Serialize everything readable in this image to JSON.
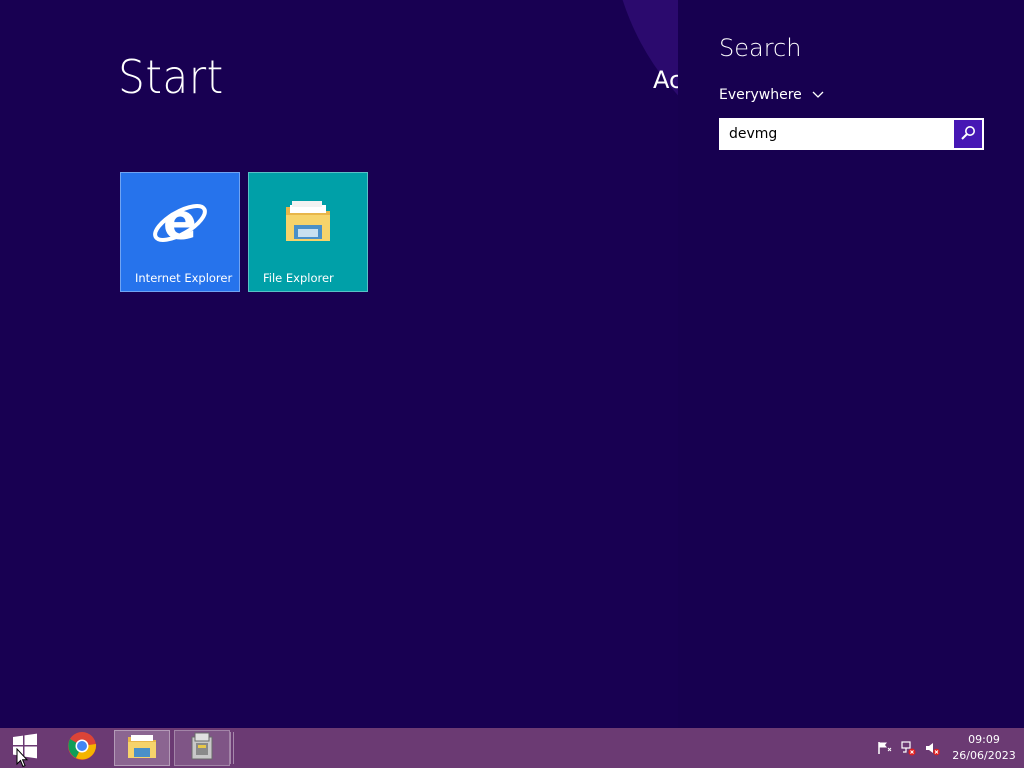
{
  "start": {
    "title": "Start",
    "account_peek": "Ac"
  },
  "tiles": [
    {
      "label": "Internet Explorer",
      "icon": "internet-explorer-icon",
      "color": "#2673ec"
    },
    {
      "label": "File Explorer",
      "icon": "folder-icon",
      "color": "#00a0a8"
    }
  ],
  "search_charm": {
    "title": "Search",
    "scope": "Everywhere",
    "query": "devmg",
    "button_icon": "magnifier-icon",
    "accent": "#4617b4"
  },
  "taskbar": {
    "apps": [
      "windows-logo-icon",
      "chrome-icon",
      "file-explorer-icon",
      "app-icon"
    ],
    "tray_icons": [
      "action-center-flag-icon",
      "network-disconnected-icon",
      "volume-muted-icon"
    ],
    "time": "09:09",
    "date": "26/06/2023",
    "color": "#6b3a73"
  },
  "colors": {
    "background": "#180052",
    "charm_background": "#170050"
  }
}
